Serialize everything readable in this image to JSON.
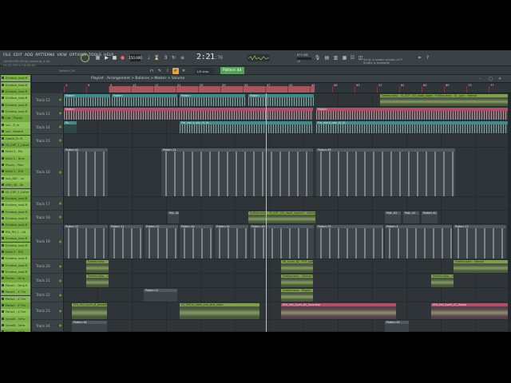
{
  "menu": [
    "FILE",
    "EDIT",
    "ADD",
    "PATTERNS",
    "VIEW",
    "OPTIONS",
    "TOOLS",
    "HELP"
  ],
  "song": {
    "line1": "18:06:000  Slinky dancing_4.flp",
    "line2": "01:21:00 hr  10:00:00"
  },
  "transport": {
    "tempo": "150.000",
    "time_main": "2:21",
    "time_sub": ":76",
    "pattern_label": "Pattern 44",
    "subbar_hint": "Pattern 29",
    "snap": "1/6 step"
  },
  "cpu": {
    "mem": "870 MB",
    "label": "11"
  },
  "news": "Scrip: A newer version of FL Studio is available",
  "playlist": {
    "title": "Playlist - Arrangement > Balance > Master > Volume"
  },
  "ruler_marks": [
    "1",
    "5",
    "9",
    "13",
    "17",
    "21",
    "25",
    "29",
    "33",
    "37",
    "41",
    "45",
    "49",
    "53",
    "57",
    "61",
    "65",
    "69",
    "73",
    "77"
  ],
  "browser_items": [
    "Endless_mod.R",
    "Endless_mod.R",
    "Endless_mod.R",
    "Endless_mod.R",
    "Endless_mod.R",
    "Endless_mod.R",
    "rub - Plucky",
    "scz - R_m",
    "scz - Reverb",
    "Gated_CL R-",
    "05_EXP_1_Lohar",
    "Multi 2 - Plu",
    "Multi 2 - Rms",
    "Plucky - Ploc",
    "Multi 1 - PLE",
    "aux_687 - sn",
    "ARH_38 - Dk",
    "05_EXP_1_Lohar",
    "Endless_mod.R",
    "Endless_mod.R",
    "Endless_mod.R",
    "Endless_mod.R",
    "Endless_mod.R",
    "Rib_RH_1 - pit",
    "Endless_mod.R",
    "Endless_mod.R",
    "Multi 2 - PLE",
    "Endless_mod.R",
    "Endless_mod.R",
    "Endless_mod.R",
    "Parsec - Dmg",
    "Parsec - Dmg K",
    "Parsec - 4 Tim",
    "Parsec - 4 Tim",
    "Parsec - 4 Tim",
    "Parsec - 4 Tim",
    "Synakt - Infra",
    "Synakt - Infra",
    "Synakt - Infra",
    "Synakt - Infra"
  ],
  "tracks": [
    {
      "label": "Track 12"
    },
    {
      "label": "Track 13"
    },
    {
      "label": "Track 14"
    },
    {
      "label": "Track 15"
    },
    {
      "label": "Track 16"
    },
    {
      "label": "Track 17"
    },
    {
      "label": "Track 18"
    },
    {
      "label": "Track 19"
    },
    {
      "label": "Track 20"
    },
    {
      "label": "Track 21"
    },
    {
      "label": "Track 22"
    },
    {
      "label": "Track 23"
    },
    {
      "label": "Track 24"
    }
  ],
  "clips": {
    "c12a": "Pattern",
    "c12b": "Endless bass - 01_EXP_150_kwad_piged - Endless bass - 01 _spin - Interval",
    "c14a": "Pa...",
    "c14b": "Pre_mid in_adv_01_flr...",
    "c16a": "Pattern 61",
    "c16b": "Pattern 24",
    "c16c": "Pattern 65",
    "c18a": "Pat...42",
    "c18b": "Endless bass - 05_EXP_150_kwad_inspired - Interval",
    "c18c": "Patt...61",
    "c18d": "Patt...41",
    "c18e": "Pattern 42",
    "c19a": "Pattern 37",
    "c19b": "Pattern 11",
    "c19c": "Pattern 12",
    "c19d": "Pattern 44",
    "c19e": "Pattern 44",
    "c19f": "Pattern 46",
    "c19g": "Pattern 39",
    "c19h": "Pattern 4",
    "c19i": "Pattern 13",
    "c20a": "Endless bass",
    "c20b": "EK_Lunch_B2 - EFX_splash",
    "c20c": "Endless bass - Interval",
    "c21a": "Endless bass - Inter",
    "c21b": "Endless bass - Interval 63",
    "c21c": "Endless bass - Interval",
    "c22a": "Pattern 47",
    "c22b": "Endless bass - Pluggrt - Interval 63",
    "c23a": "EFX_040_Synth_B_whoosh",
    "c23b": "04_EXP_fx_fader_one_shot_down",
    "c23c": "EFX_040_Synth_B2_Soncrimp",
    "c23d": "EFX_040_Synth_02_Tempo",
    "c24a": "Pattern 48",
    "c24b": "Pattern 49"
  }
}
